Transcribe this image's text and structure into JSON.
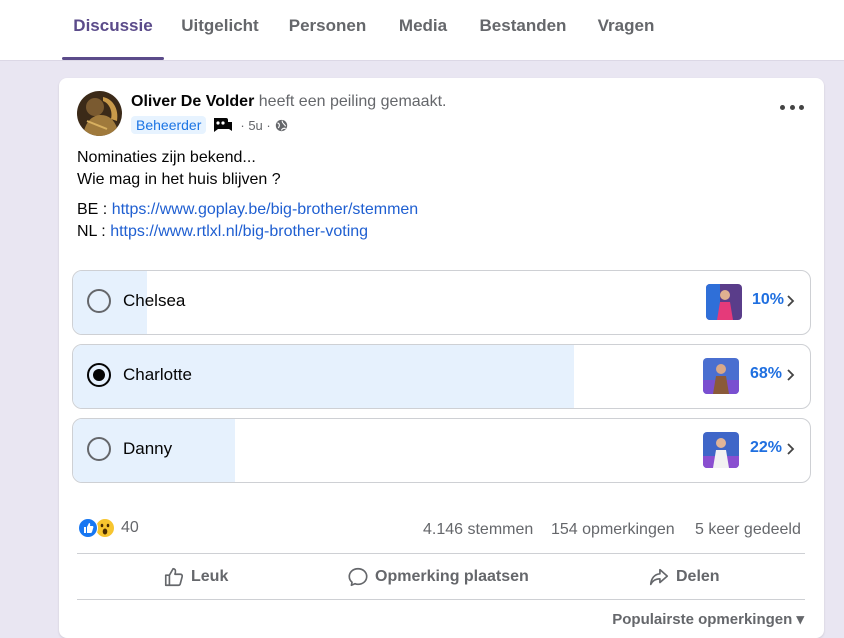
{
  "tabs": [
    {
      "label": "Discussie",
      "active": true
    },
    {
      "label": "Uitgelicht"
    },
    {
      "label": "Personen"
    },
    {
      "label": "Media"
    },
    {
      "label": "Bestanden"
    },
    {
      "label": "Vragen"
    }
  ],
  "post": {
    "author": "Oliver De Volder",
    "action": "heeft een peiling gemaakt.",
    "badge": "Beheerder",
    "time": "· 5u ·",
    "text_line1": "Nominaties zijn bekend...",
    "text_line2": "Wie mag in het huis blijven ?",
    "be_prefix": "BE : ",
    "be_link": "https://www.goplay.be/big-brother/stemmen",
    "nl_prefix": "NL : ",
    "nl_link": "https://www.rtlxl.nl/big-brother-voting"
  },
  "poll": {
    "options": [
      {
        "label": "Chelsea",
        "percent": "10%",
        "share": 0.1,
        "selected": false
      },
      {
        "label": "Charlotte",
        "percent": "68%",
        "share": 0.68,
        "selected": true
      },
      {
        "label": "Danny",
        "percent": "22%",
        "share": 0.22,
        "selected": false
      }
    ]
  },
  "footer": {
    "reaction_count": "40",
    "votes": "4.146 stemmen",
    "comments": "154 opmerkingen",
    "shares": "5 keer gedeeld",
    "like": "Leuk",
    "comment": "Opmerking plaatsen",
    "share": "Delen",
    "sort": "Populairste opmerkingen"
  },
  "colors": {
    "accent": "#5b4b8a",
    "link": "#1f5fd1",
    "poll_fill": "#e6f1fd",
    "percent": "#1f6fe0"
  },
  "icons": [
    "ellipsis-icon",
    "globe-icon",
    "community-chat-icon",
    "like-reaction-icon",
    "wow-reaction-icon",
    "thumbs-up-icon",
    "comment-icon",
    "share-icon",
    "chevron-right-icon",
    "chevron-down-icon"
  ]
}
